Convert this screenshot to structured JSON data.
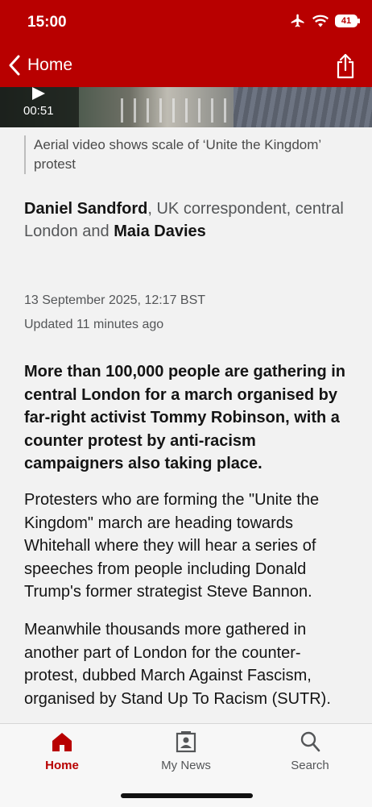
{
  "status_bar": {
    "time": "15:00",
    "battery": "41",
    "icons": [
      "airplane-icon",
      "wifi-icon",
      "battery-icon"
    ]
  },
  "nav": {
    "back_label": "Home",
    "share_icon": "share-icon"
  },
  "video": {
    "duration": "00:51",
    "caption": "Aerial video shows scale of ‘Unite the Kingdom’ protest"
  },
  "byline": {
    "author1": "Daniel Sandford",
    "role": ", UK correspondent, central London and ",
    "author2": "Maia Davies"
  },
  "article": {
    "date": "13 September 2025, 12:17 BST",
    "updated": "Updated 11 minutes ago",
    "lead": "More than 100,000 people are gathering in central London for a march organised by far-right activist Tommy Robinson, with a counter protest by anti-racism campaigners also taking place.",
    "paragraphs": [
      "Protesters who are forming the \"Unite the Kingdom\" march are heading towards Whitehall where they will hear a series of speeches from people including Donald Trump's former strategist Steve Bannon.",
      "Meanwhile thousands more gathered in another part of London for the counter-protest, dubbed March Against Fascism, organised by Stand Up To Racism (SUTR)."
    ]
  },
  "tabs": [
    {
      "label": "Home",
      "icon": "home-icon",
      "active": true
    },
    {
      "label": "My News",
      "icon": "my-news-icon",
      "active": false
    },
    {
      "label": "Search",
      "icon": "search-icon",
      "active": false
    }
  ],
  "colors": {
    "brand": "#b80000",
    "text": "#141414",
    "muted": "#545658"
  }
}
